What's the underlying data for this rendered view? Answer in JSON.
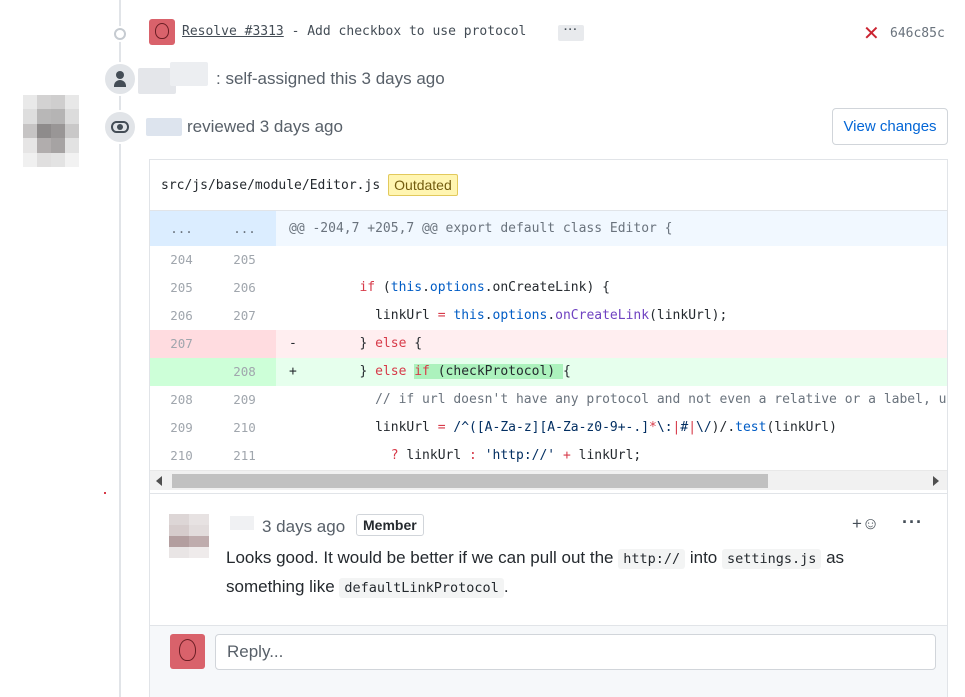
{
  "commit": {
    "link_text": "Resolve #3313",
    "message_rest": " - Add checkbox to use protocol",
    "ellipsis": "···",
    "status_icon": "✕",
    "sha": "646c85c"
  },
  "assign_event": {
    "text": ": self-assigned this 3 days ago"
  },
  "review_event": {
    "text": "reviewed 3 days ago",
    "view_changes_label": "View changes"
  },
  "file": {
    "path": "src/js/base/module/Editor.js",
    "badge": "Outdated"
  },
  "diff": {
    "hunk": {
      "left": "...",
      "right": "...",
      "text": "@@ -204,7 +205,7 @@ export default class Editor {"
    },
    "lines": [
      {
        "left": "204",
        "right": "205",
        "sign": " "
      },
      {
        "left": "205",
        "right": "206",
        "sign": " "
      },
      {
        "left": "206",
        "right": "207",
        "sign": " "
      },
      {
        "left": "207",
        "right": "",
        "sign": "-"
      },
      {
        "left": "",
        "right": "208",
        "sign": "+"
      },
      {
        "left": "208",
        "right": "209",
        "sign": " "
      },
      {
        "left": "209",
        "right": "210",
        "sign": " "
      },
      {
        "left": "210",
        "right": "211",
        "sign": " "
      }
    ]
  },
  "comment": {
    "time": "3 days ago",
    "role_badge": "Member",
    "react_label": "+☺",
    "more_label": "···",
    "body_1": "Looks good. It would be better if we can pull out the ",
    "code_1": "http://",
    "body_2": " into ",
    "code_2": "settings.js",
    "body_3": " as something like ",
    "code_3": "defaultLinkProtocol",
    "body_4": "."
  },
  "reply": {
    "placeholder": "Reply..."
  }
}
